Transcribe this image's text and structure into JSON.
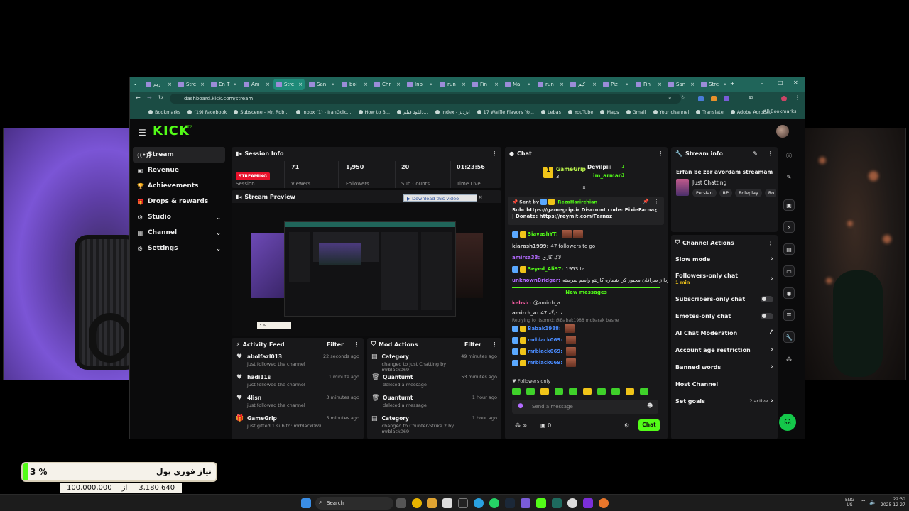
{
  "browser": {
    "tabs": [
      {
        "label": "ریم"
      },
      {
        "label": "Stre"
      },
      {
        "label": "En T"
      },
      {
        "label": "Am"
      },
      {
        "label": "Stre"
      },
      {
        "label": "San"
      },
      {
        "label": "bol"
      },
      {
        "label": "Chr"
      },
      {
        "label": "Inb"
      },
      {
        "label": "run"
      },
      {
        "label": "Fin"
      },
      {
        "label": "Ma"
      },
      {
        "label": "run"
      },
      {
        "label": "کیم"
      },
      {
        "label": "Piz"
      },
      {
        "label": "Fin"
      },
      {
        "label": "San"
      },
      {
        "label": "Stre"
      }
    ],
    "url": "dashboard.kick.com/stream",
    "bookmarks": [
      "Bookmarks",
      "(19) Facebook",
      "Subscene - Mr. Rob...",
      "Inbox (1) - IranGdic...",
      "How to B...",
      "دانلود فیلم...",
      "Index - ایزدپز",
      "17 Waffle Flavors Yo...",
      "Lebas",
      "YouTube",
      "Maps",
      "Gmail",
      "Your channel",
      "Translate",
      "Adobe Acrobat"
    ],
    "all_bookmarks": "All Bookmarks"
  },
  "kick": {
    "logo": "KICK",
    "beta": "BETA",
    "nav": [
      {
        "label": "Stream",
        "icon": "stream-icon",
        "glyph": "((•))"
      },
      {
        "label": "Revenue",
        "icon": "revenue-icon",
        "glyph": "▣"
      },
      {
        "label": "Achievements",
        "icon": "trophy-icon",
        "glyph": "🏆"
      },
      {
        "label": "Drops & rewards",
        "icon": "gift-icon",
        "glyph": "🎁"
      },
      {
        "label": "Studio",
        "icon": "studio-icon",
        "glyph": "⚙"
      },
      {
        "label": "Channel",
        "icon": "channel-icon",
        "glyph": "▦"
      },
      {
        "label": "Settings",
        "icon": "settings-icon",
        "glyph": "⚙"
      }
    ],
    "session": {
      "title": "Session Info",
      "status": "STREAMING",
      "session_label": "Session",
      "viewers": "71",
      "viewers_label": "Viewers",
      "followers": "1,950",
      "followers_label": "Followers",
      "subs": "20",
      "subs_label": "Sub Counts",
      "time": "01:23:56",
      "time_label": "Time Live"
    },
    "preview": {
      "title": "Stream Preview",
      "download": "Download this video"
    },
    "activity": {
      "title": "Activity Feed",
      "filter": "Filter",
      "items": [
        {
          "user": "abolfazl013",
          "desc": "just followed the channel",
          "when": "22 seconds ago"
        },
        {
          "user": "hadi11s",
          "desc": "just followed the channel",
          "when": "1 minute ago"
        },
        {
          "user": "4lisn",
          "desc": "just followed the channel",
          "when": "3 minutes ago"
        },
        {
          "user": "GameGrip",
          "desc": "just gifted 1 sub to: mrblack069",
          "when": "5 minutes ago"
        }
      ]
    },
    "mod": {
      "title": "Mod Actions",
      "filter": "Filter",
      "items": [
        {
          "title": "Category",
          "desc": "changed to Just Chatting by mrblack069",
          "when": "49 minutes ago"
        },
        {
          "title": "Quantumt",
          "desc": "deleted a message",
          "when": "53 minutes ago"
        },
        {
          "title": "Quantumt",
          "desc": "deleted a message",
          "when": "1 hour ago"
        },
        {
          "title": "Category",
          "desc": "changed to Counter-Strike 2 by mrblack069",
          "when": "1 hour ago"
        }
      ]
    },
    "chat": {
      "title": "Chat",
      "top_users": [
        {
          "name": "GameGrip",
          "count": "3"
        },
        {
          "name": "Devilpiii",
          "count": "1"
        },
        {
          "name": "im_arman",
          "count": "1"
        }
      ],
      "pinned_sent_by": "Sent by",
      "pinned_user": "RezaHarirchian",
      "pinned_text_1": "Sub: https://gamegrip.ir Discount code: PixieFarnaz",
      "pinned_text_2": "| Donate: https://reymit.com/Farnaz",
      "messages": [
        {
          "user": "SiavashYT:",
          "text": ""
        },
        {
          "user": "kiarash1999:",
          "text": "47 followers to go"
        },
        {
          "user": "amirsa33:",
          "text": "لاک کاری"
        },
        {
          "user": "Seyed_Ali97:",
          "text": "1953 ta"
        },
        {
          "user": "unknownBridger:",
          "text": "فردا ز صرافان مجبور کن شماره کارتتو واسم بفرسته"
        }
      ],
      "new_messages": "New messages",
      "messages2": [
        {
          "user": "kebsir:",
          "text": "@amirrh_a"
        },
        {
          "user": "amirrh_a:",
          "text": "47 تا دیگه"
        },
        {
          "user": "Babak1988:",
          "text": ""
        },
        {
          "user": "mrblack069:",
          "text": ""
        },
        {
          "user": "mrblack069:",
          "text": ""
        },
        {
          "user": "mrblack069:",
          "text": ""
        }
      ],
      "reply_note": "Replying to itsomid: @Babak1988 mobarak bashe",
      "followers_only": "Followers only",
      "placeholder": "Send a message",
      "infinity": "∞",
      "zero": "0",
      "send": "Chat"
    },
    "stream_info": {
      "title": "Stream info",
      "stream_title": "Erfan be zor avordam streamam",
      "category": "Just Chatting",
      "tags": [
        "Persian",
        "RP",
        "Roleplay",
        "Ro"
      ]
    },
    "channel_actions": {
      "title": "Channel Actions",
      "rows": [
        {
          "label": "Slow mode",
          "sub": ""
        },
        {
          "label": "Followers-only chat",
          "sub": "1 min"
        },
        {
          "label": "Subscribers-only chat",
          "sub": ""
        },
        {
          "label": "Emotes-only chat",
          "sub": ""
        },
        {
          "label": "AI Chat Moderation",
          "sub": ""
        },
        {
          "label": "Account age restriction",
          "sub": ""
        },
        {
          "label": "Banned words",
          "sub": ""
        },
        {
          "label": "Host Channel",
          "sub": ""
        },
        {
          "label": "Set goals",
          "sub": ""
        }
      ],
      "goals_active": "2 active"
    }
  },
  "donate": {
    "label": "نیاز فوری پول",
    "percent": "3 %",
    "goal": "100,000,000",
    "separator": "از",
    "raised": "3,180,640",
    "progress_fraction": 0.03
  },
  "taskbar": {
    "search": "Search",
    "lang_1": "ENG",
    "lang_2": "US",
    "time": "22:30",
    "date": "2025-12-27"
  },
  "colors": {
    "kick_green": "#53fc18",
    "live_red": "#e9112b",
    "tab_teal": "#20655a"
  }
}
